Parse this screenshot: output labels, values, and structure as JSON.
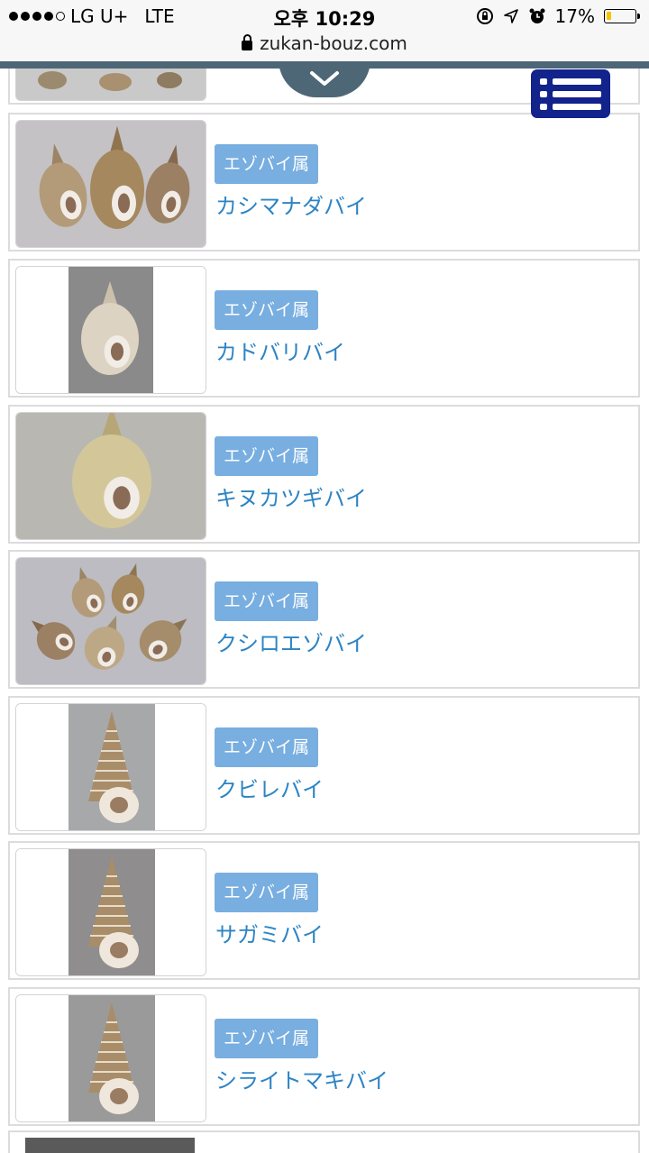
{
  "status_bar": {
    "carrier": "LG U+",
    "network": "LTE",
    "time": "오후 10:29",
    "battery": "17%",
    "battery_level": 0.17
  },
  "browser": {
    "url": "zukan-bouz.com"
  },
  "items": [
    {
      "genus": "エゾバイ属",
      "name": "カシマナダバイ",
      "bg": "#c4c2c4",
      "layout": "group3"
    },
    {
      "genus": "エゾバイ属",
      "name": "カドバリバイ",
      "bg": "#8a8a8a",
      "layout": "single-narrow"
    },
    {
      "genus": "エゾバイ属",
      "name": "キヌカツギバイ",
      "bg": "#b9b7b2",
      "layout": "single-wide"
    },
    {
      "genus": "エゾバイ属",
      "name": "クシロエゾバイ",
      "bg": "#bcbcc2",
      "layout": "group5"
    },
    {
      "genus": "エゾバイ属",
      "name": "クビレバイ",
      "bg": "#a7a8aa",
      "layout": "spire"
    },
    {
      "genus": "エゾバイ属",
      "name": "サガミバイ",
      "bg": "#8f8d8d",
      "layout": "spire"
    },
    {
      "genus": "エゾバイ属",
      "name": "シライトマキバイ",
      "bg": "#9a9a9a",
      "layout": "spire"
    }
  ],
  "icons": {
    "scroll_down": "chevron-down-icon",
    "menu": "menu-list-icon",
    "lock": "lock-icon"
  }
}
